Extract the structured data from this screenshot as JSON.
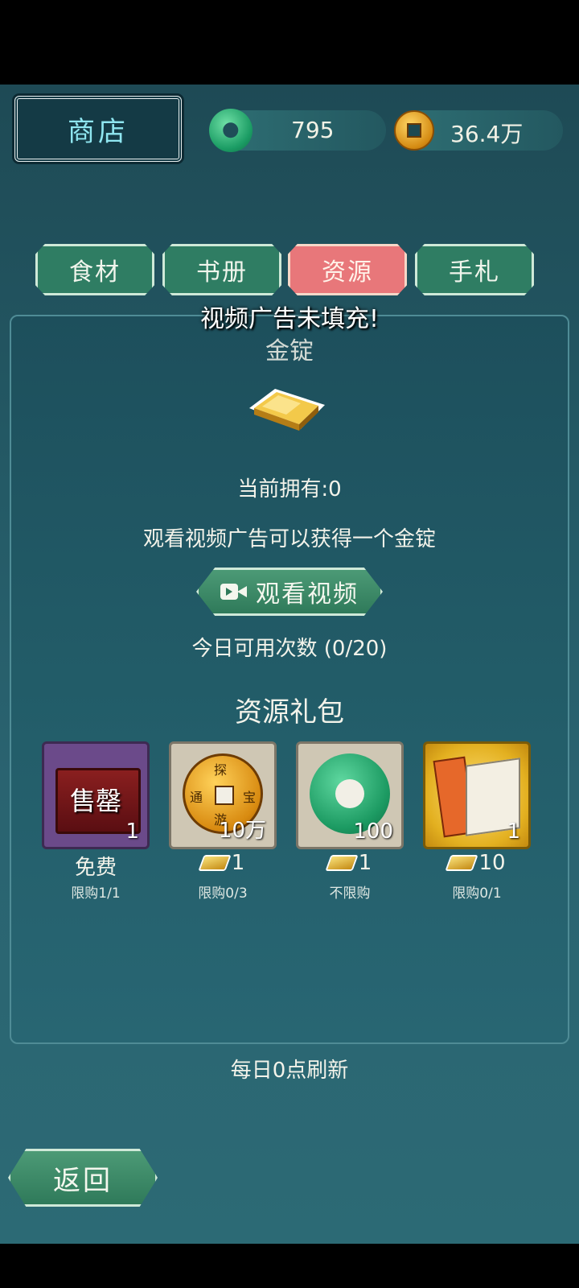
{
  "header": {
    "title": "商店",
    "jade_count": "795",
    "coin_count": "36.4万"
  },
  "tabs": [
    {
      "label": "食材",
      "active": false
    },
    {
      "label": "书册",
      "active": false
    },
    {
      "label": "资源",
      "active": true
    },
    {
      "label": "手札",
      "active": false
    }
  ],
  "toast": "视频广告未填充!",
  "featured": {
    "name": "金锭",
    "owned": "当前拥有:0",
    "description": "观看视频广告可以获得一个金锭",
    "watch_button": "观看视频",
    "uses": "今日可用次数 (0/20)"
  },
  "packs": {
    "title": "资源礼包",
    "items": [
      {
        "icon": "chest-icon",
        "badge": "售罄",
        "qty": "1",
        "price": "免费",
        "limit": "限购1/1"
      },
      {
        "icon": "coin-icon",
        "coin_chars": [
          "探",
          "宝",
          "游",
          "通"
        ],
        "qty": "10万",
        "price": "1",
        "limit": "限购0/3"
      },
      {
        "icon": "jade-icon",
        "qty": "100",
        "price": "1",
        "limit": "不限购"
      },
      {
        "icon": "scroll-icon",
        "qty": "1",
        "price": "10",
        "limit": "限购0/1"
      }
    ]
  },
  "refresh_note": "每日0点刷新",
  "back_button": "返回",
  "colors": {
    "background": "#245a66",
    "tab_active": "#e8777a",
    "tab_inactive": "#2f7d63",
    "button_green": "#3e8a6c",
    "title_text": "#8fe6f0"
  }
}
